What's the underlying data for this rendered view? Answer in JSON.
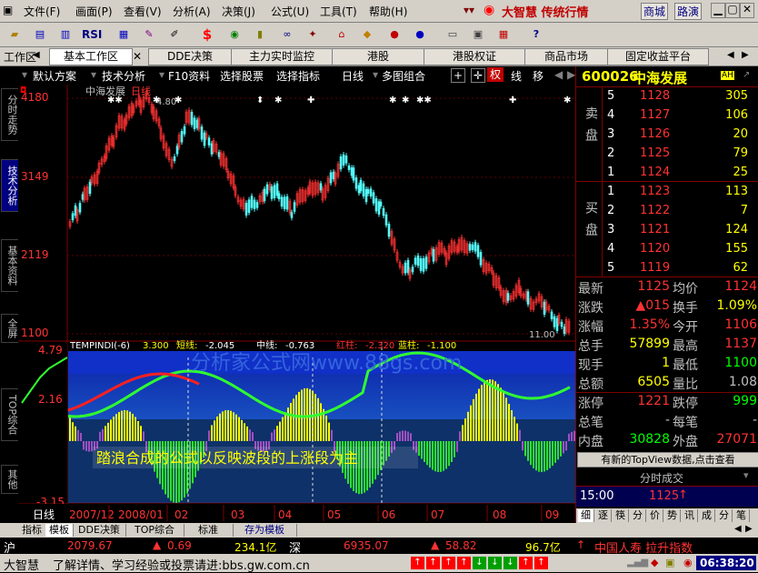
{
  "menu": {
    "items": [
      "文件(F)",
      "画面(P)",
      "查看(V)",
      "分析(A)",
      "决策(J)",
      "公式(U)",
      "工具(T)",
      "帮助(H)"
    ],
    "brand": "大智慧 传统行情",
    "buttons": [
      "商城",
      "路演"
    ]
  },
  "toolbar": {
    "icons": [
      "RSI",
      "$",
      "?"
    ]
  },
  "tabs": {
    "workspace_label": "工作区",
    "items": [
      "基本工作区",
      "DDE决策",
      "主力实时监控",
      "港股",
      "港股权证",
      "商品市场",
      "固定收益平台"
    ]
  },
  "chartbar": {
    "items": [
      "默认方案",
      "技术分析",
      "F10资料",
      "选择股票",
      "选择指标",
      "日线",
      "多图组合"
    ],
    "toggles": [
      "权",
      "线",
      "移"
    ]
  },
  "sidebar": {
    "tabs": [
      "分时走势",
      "技术分析",
      "基本资料",
      "全屏",
      "TOP综合",
      "其他"
    ]
  },
  "chart": {
    "title": "中海发展",
    "period": "日线",
    "high_label": "4.80",
    "low_label": "11.00",
    "price_axis": [
      "4180",
      "3149",
      "2119",
      "1100"
    ],
    "indicator": {
      "name": "TEMPINDI(-6)",
      "value": "3.300",
      "short_label": "短线:",
      "short_value": "-2.045",
      "mid_label": "中线:",
      "mid_value": "-0.763",
      "red_label": "红柱:",
      "red_value": "-2.320",
      "blue_label": "蓝柱:",
      "blue_value": "-1.100",
      "axis": [
        "4.79",
        "2.16",
        "-3.15"
      ]
    },
    "watermark": "分析家公式网www.88gs.com",
    "caption": "踏浪合成的公式以反映波段的上涨段为主",
    "period_label": "日线",
    "dates": [
      "2007/12",
      "2008/01",
      "02",
      "03",
      "04",
      "05",
      "06",
      "07",
      "08",
      "09"
    ]
  },
  "stock": {
    "code": "600026",
    "name": "中海发展",
    "badge": "AH"
  },
  "orderbook": {
    "sell_label": "卖盘",
    "buy_label": "买盘",
    "sell": [
      {
        "level": "5",
        "price": "1128",
        "volume": "305"
      },
      {
        "level": "4",
        "price": "1127",
        "volume": "106"
      },
      {
        "level": "3",
        "price": "1126",
        "volume": "20"
      },
      {
        "level": "2",
        "price": "1125",
        "volume": "79"
      },
      {
        "level": "1",
        "price": "1124",
        "volume": "25"
      }
    ],
    "buy": [
      {
        "level": "1",
        "price": "1123",
        "volume": "113"
      },
      {
        "level": "2",
        "price": "1122",
        "volume": "7"
      },
      {
        "level": "3",
        "price": "1121",
        "volume": "124"
      },
      {
        "level": "4",
        "price": "1120",
        "volume": "155"
      },
      {
        "level": "5",
        "price": "1119",
        "volume": "62"
      }
    ]
  },
  "quote": [
    {
      "l1": "最新",
      "v1": "1125",
      "l2": "均价",
      "v2": "1124"
    },
    {
      "l1": "涨跌",
      "v1": "▲015",
      "l2": "换手",
      "v2": "1.09%"
    },
    {
      "l1": "涨幅",
      "v1": "1.35%",
      "l2": "今开",
      "v2": "1106"
    },
    {
      "l1": "总手",
      "v1": "57899",
      "l2": "最高",
      "v2": "1137"
    },
    {
      "l1": "现手",
      "v1": "1",
      "l2": "最低",
      "v2": "1100"
    },
    {
      "l1": "总额",
      "v1": "6505",
      "l2": "量比",
      "v2": "1.08"
    },
    {
      "l1": "涨停",
      "v1": "1221",
      "l2": "跌停",
      "v2": "999"
    },
    {
      "l1": "总笔",
      "v1": "-",
      "l2": "每笔",
      "v2": "-"
    },
    {
      "l1": "内盘",
      "v1": "30828",
      "l2": "外盘",
      "v2": "27071"
    }
  ],
  "topview_notice": "有新的TopView数据,点击查看",
  "ticks": {
    "header": "分时成交",
    "time": "15:00",
    "price": "1125"
  },
  "right_tabs": [
    "细",
    "逐",
    "筷",
    "分",
    "价",
    "势",
    "讯",
    "成",
    "分",
    "笔"
  ],
  "bottom_tabs": [
    "指标",
    "模板",
    "DDE决策",
    "TOP综合",
    "标准",
    "存为模板"
  ],
  "status": {
    "sh_label": "沪",
    "sh_index": "2079.67",
    "sh_change": "0.69",
    "sh_amount": "234.1亿",
    "sz_label": "深",
    "sz_index": "6935.07",
    "sz_change": "58.82",
    "sz_amount": "96.7亿",
    "ticker": "中国人寿 拉升指数",
    "time": "06:38:20",
    "brand": "大智慧",
    "message": "了解详情、学习经验或投票请进:bbs.gw.com.cn"
  },
  "colors": {
    "up": "#ff3232",
    "down": "#00ffff",
    "cyan_candle": "#54fcfc",
    "yellow": "#ffff00",
    "bg_menu": "#d4d0c8"
  }
}
